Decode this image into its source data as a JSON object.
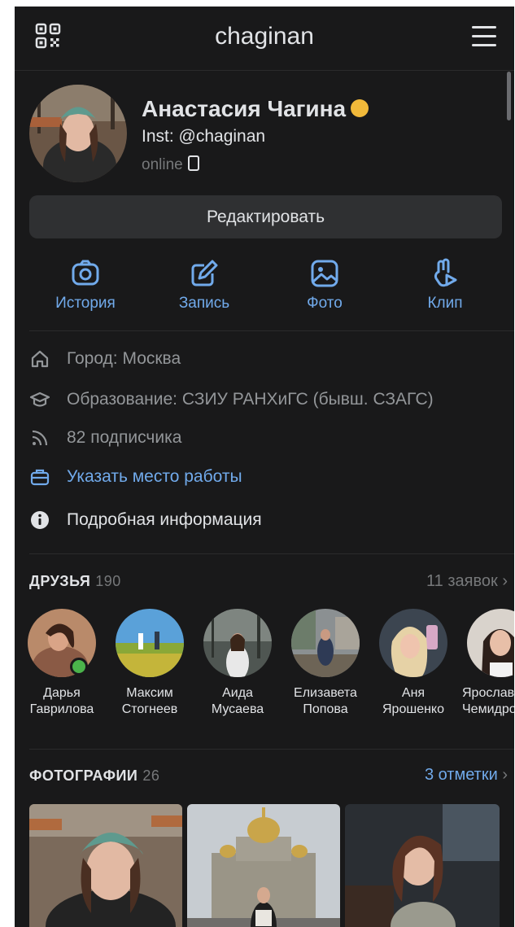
{
  "header": {
    "title": "chaginan"
  },
  "profile": {
    "name": "Анастасия Чагина",
    "status": "Inst: @chaginan",
    "online": "online",
    "edit_label": "Редактировать"
  },
  "actions": [
    {
      "label": "История",
      "icon": "camera-icon"
    },
    {
      "label": "Запись",
      "icon": "edit-icon"
    },
    {
      "label": "Фото",
      "icon": "photo-icon"
    },
    {
      "label": "Клип",
      "icon": "clip-icon"
    }
  ],
  "info": {
    "city": "Город: Москва",
    "education": "Образование: СЗИУ РАНХиГС (бывш. СЗАГС)",
    "followers": "82 подписчика",
    "work": "Указать место работы",
    "more": "Подробная информация"
  },
  "friends": {
    "title": "ДРУЗЬЯ",
    "count": "190",
    "requests": "11 заявок",
    "items": [
      {
        "first": "Дарья",
        "last": "Гаврилова",
        "online": true
      },
      {
        "first": "Максим",
        "last": "Стогнеев",
        "online": false
      },
      {
        "first": "Аида",
        "last": "Мусаева",
        "online": false
      },
      {
        "first": "Елизавета",
        "last": "Попова",
        "online": false
      },
      {
        "first": "Аня",
        "last": "Ярошенко",
        "online": false
      },
      {
        "first": "Ярослава",
        "last": "Чемидронова",
        "online": false
      }
    ]
  },
  "photos": {
    "title": "ФОТОГРАФИИ",
    "count": "26",
    "tags": "3 отметки"
  },
  "colors": {
    "background": "#19191a",
    "accent": "#71aaeb",
    "muted": "#939699",
    "button": "#2f3032",
    "online": "#4bb34b"
  }
}
